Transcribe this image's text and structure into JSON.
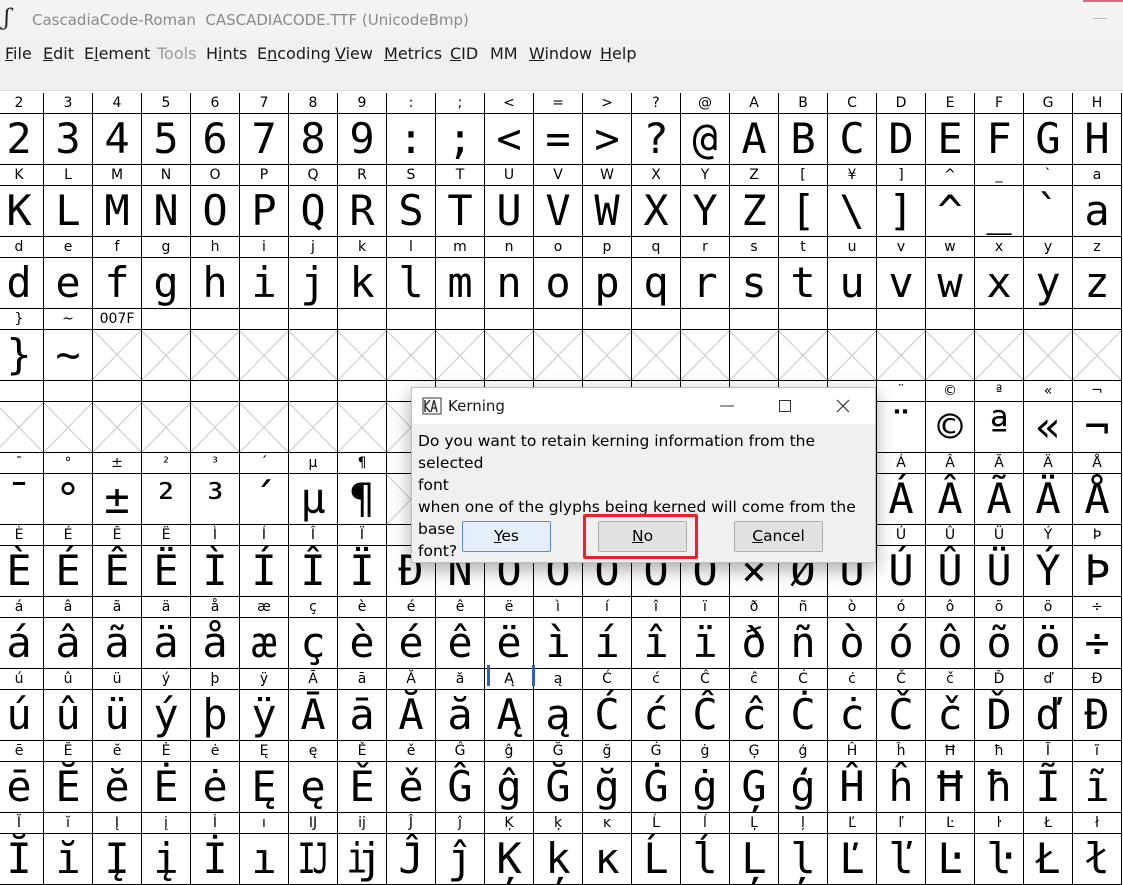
{
  "window": {
    "title": "CascadiaCode-Roman  CASCADIACODE.TTF (UnicodeBmp)",
    "icon": "fontforge-icon"
  },
  "menu": [
    {
      "label": "File",
      "ul": "F",
      "rest": "ile",
      "enabled": true
    },
    {
      "label": "Edit",
      "ul": "E",
      "rest": "dit",
      "enabled": true
    },
    {
      "label": "Element",
      "pre": "E",
      "ul": "l",
      "rest": "ement",
      "enabled": true
    },
    {
      "label": "Tools",
      "ul": "",
      "rest": "Tools",
      "enabled": false
    },
    {
      "label": "Hints",
      "pre": "H",
      "ul": "i",
      "rest": "nts",
      "enabled": true
    },
    {
      "label": "Encoding",
      "pre": "E",
      "ul": "n",
      "rest": "coding",
      "enabled": true
    },
    {
      "label": "View",
      "ul": "V",
      "rest": "iew",
      "enabled": true
    },
    {
      "label": "Metrics",
      "ul": "M",
      "rest": "etrics",
      "enabled": true
    },
    {
      "label": "CID",
      "ul": "C",
      "rest": "ID",
      "enabled": true
    },
    {
      "label": "MM",
      "ul": "",
      "rest": "MM",
      "enabled": true
    },
    {
      "label": "Window",
      "ul": "W",
      "rest": "indow",
      "enabled": true
    },
    {
      "label": "Help",
      "ul": "H",
      "rest": "elp",
      "enabled": true
    }
  ],
  "grid": {
    "rows": [
      {
        "labels": [
          "2",
          "3",
          "4",
          "5",
          "6",
          "7",
          "8",
          "9",
          ":",
          ";",
          "<",
          "=",
          ">",
          "?",
          "@",
          "A",
          "B",
          "C",
          "D",
          "E",
          "F",
          "G",
          "H"
        ],
        "glyphs": [
          "2",
          "3",
          "4",
          "5",
          "6",
          "7",
          "8",
          "9",
          ":",
          ";",
          "<",
          "=",
          ">",
          "?",
          "@",
          "A",
          "B",
          "C",
          "D",
          "E",
          "F",
          "G",
          "H"
        ]
      },
      {
        "labels": [
          "K",
          "L",
          "M",
          "N",
          "O",
          "P",
          "Q",
          "R",
          "S",
          "T",
          "U",
          "V",
          "W",
          "X",
          "Y",
          "Z",
          "[",
          "¥",
          "]",
          "^",
          "_",
          "`",
          "a"
        ],
        "glyphs": [
          "K",
          "L",
          "M",
          "N",
          "O",
          "P",
          "Q",
          "R",
          "S",
          "T",
          "U",
          "V",
          "W",
          "X",
          "Y",
          "Z",
          "[",
          "\\",
          "]",
          "^",
          "_",
          "`",
          "a"
        ]
      },
      {
        "labels": [
          "d",
          "e",
          "f",
          "g",
          "h",
          "i",
          "j",
          "k",
          "l",
          "m",
          "n",
          "o",
          "p",
          "q",
          "r",
          "s",
          "t",
          "u",
          "v",
          "w",
          "x",
          "y",
          "z"
        ],
        "glyphs": [
          "d",
          "e",
          "f",
          "g",
          "h",
          "i",
          "j",
          "k",
          "l",
          "m",
          "n",
          "o",
          "p",
          "q",
          "r",
          "s",
          "t",
          "u",
          "v",
          "w",
          "x",
          "y",
          "z"
        ]
      },
      {
        "labels": [
          "}",
          "~",
          "007F",
          "",
          "",
          "",
          "",
          "",
          "",
          "",
          "",
          "",
          "",
          "",
          "",
          "",
          "",
          "",
          "",
          "",
          "",
          "",
          ""
        ],
        "glyphs": [
          "}",
          "~",
          "",
          "",
          "",
          "",
          "",
          "",
          "",
          "",
          "",
          "",
          "",
          "",
          "",
          "",
          "",
          "",
          "",
          "",
          "",
          "",
          ""
        ]
      },
      {
        "labels": [
          "",
          "",
          "",
          "",
          "",
          "",
          "",
          "",
          "",
          "",
          "",
          "",
          "",
          "",
          "",
          "",
          "",
          "",
          "¨",
          "©",
          "ª",
          "«",
          "¬"
        ],
        "glyphs": [
          "",
          "",
          "",
          "",
          "",
          "",
          "",
          "",
          "",
          "",
          "",
          "",
          "",
          "",
          "",
          "",
          "",
          "",
          "¨",
          "©",
          "ª",
          "«",
          "¬"
        ]
      },
      {
        "labels": [
          "¯",
          "°",
          "±",
          "²",
          "³",
          "´",
          "µ",
          "¶",
          "",
          "",
          "",
          "",
          "",
          "",
          "",
          "",
          "",
          "",
          "Á",
          "Â",
          "Ã",
          "Ä",
          "Å"
        ],
        "glyphs": [
          "¯",
          "°",
          "±",
          "²",
          "³",
          "´",
          "µ",
          "¶",
          "",
          "",
          "",
          "",
          "",
          "",
          "",
          "",
          "",
          "",
          "Á",
          "Â",
          "Ã",
          "Ä",
          "Å"
        ]
      },
      {
        "labels": [
          "È",
          "É",
          "Ê",
          "Ë",
          "Ì",
          "Í",
          "Î",
          "Ï",
          "",
          "",
          "",
          "",
          "",
          "",
          "",
          "",
          "",
          "",
          "Ú",
          "Û",
          "Ü",
          "Ý",
          "Þ"
        ],
        "glyphs": [
          "È",
          "É",
          "Ê",
          "Ë",
          "Ì",
          "Í",
          "Î",
          "Ï",
          "Ð",
          "Ñ",
          "Ò",
          "Ó",
          "Ô",
          "Õ",
          "Ö",
          "×",
          "Ø",
          "Ù",
          "Ú",
          "Û",
          "Ü",
          "Ý",
          "Þ"
        ]
      },
      {
        "labels": [
          "á",
          "â",
          "ã",
          "ä",
          "å",
          "æ",
          "ç",
          "è",
          "é",
          "ê",
          "ë",
          "ì",
          "í",
          "î",
          "ï",
          "ð",
          "ñ",
          "ò",
          "ó",
          "ô",
          "õ",
          "ö",
          "÷"
        ],
        "glyphs": [
          "á",
          "â",
          "ã",
          "ä",
          "å",
          "æ",
          "ç",
          "è",
          "é",
          "ê",
          "ë",
          "ì",
          "í",
          "î",
          "ï",
          "ð",
          "ñ",
          "ò",
          "ó",
          "ô",
          "õ",
          "ö",
          "÷"
        ]
      },
      {
        "labels": [
          "ú",
          "û",
          "ü",
          "ý",
          "þ",
          "ÿ",
          "Ā",
          "ā",
          "Ă",
          "ă",
          "Ą",
          "ą",
          "Ć",
          "ć",
          "Ĉ",
          "ĉ",
          "Ċ",
          "ċ",
          "Č",
          "č",
          "Ď",
          "ď",
          "Đ"
        ],
        "glyphs": [
          "ú",
          "û",
          "ü",
          "ý",
          "þ",
          "ÿ",
          "Ā",
          "ā",
          "Ă",
          "ă",
          "Ą",
          "ą",
          "Ć",
          "ć",
          "Ĉ",
          "ĉ",
          "Ċ",
          "ċ",
          "Č",
          "č",
          "Ď",
          "ď",
          "Đ"
        ]
      },
      {
        "labels": [
          "ē",
          "Ĕ",
          "ĕ",
          "Ė",
          "ė",
          "Ę",
          "ę",
          "Ě",
          "ě",
          "Ĝ",
          "ĝ",
          "Ğ",
          "ğ",
          "Ġ",
          "ġ",
          "Ģ",
          "ģ",
          "Ĥ",
          "ĥ",
          "Ħ",
          "ħ",
          "Ĩ",
          "ĩ"
        ],
        "glyphs": [
          "ē",
          "Ĕ",
          "ĕ",
          "Ė",
          "ė",
          "Ę",
          "ę",
          "Ě",
          "ě",
          "Ĝ",
          "ĝ",
          "Ğ",
          "ğ",
          "Ġ",
          "ġ",
          "Ģ",
          "ģ",
          "Ĥ",
          "ĥ",
          "Ħ",
          "ħ",
          "Ĩ",
          "ĩ"
        ]
      },
      {
        "labels": [
          "Ĭ",
          "ĭ",
          "Į",
          "į",
          "İ",
          "ı",
          "Ĳ",
          "ĳ",
          "Ĵ",
          "ĵ",
          "Ķ",
          "ķ",
          "ĸ",
          "Ĺ",
          "ĺ",
          "Ļ",
          "ļ",
          "Ľ",
          "ľ",
          "Ŀ",
          "ŀ",
          "Ł",
          "ł"
        ],
        "glyphs": [
          "Ĭ",
          "ĭ",
          "Į",
          "į",
          "İ",
          "ı",
          "Ĳ",
          "ĳ",
          "Ĵ",
          "ĵ",
          "Ķ",
          "ķ",
          "ĸ",
          "Ĺ",
          "ĺ",
          "Ļ",
          "ļ",
          "Ľ",
          "ľ",
          "Ŀ",
          "ŀ",
          "Ł",
          "ł"
        ]
      }
    ]
  },
  "dialog": {
    "title": "Kerning",
    "icon": "fontforge-kerning-icon",
    "message_lines": [
      "Do you want to retain kerning information from the selected",
      "font",
      "when one of the glyphs being kerned will come from the base",
      "font?"
    ],
    "buttons": {
      "yes": {
        "label": "Yes",
        "ul": "Y",
        "rest": "es"
      },
      "no": {
        "label": "No",
        "ul": "N",
        "rest": "o"
      },
      "cancel": {
        "label": "Cancel",
        "ul": "C",
        "rest": "ancel"
      }
    },
    "highlight_color": "#e8222b"
  },
  "colors": {
    "menubar_bg": "#f0f0f0",
    "dialog_bg": "#f0f0f0",
    "selection": "#2f5fbf"
  }
}
